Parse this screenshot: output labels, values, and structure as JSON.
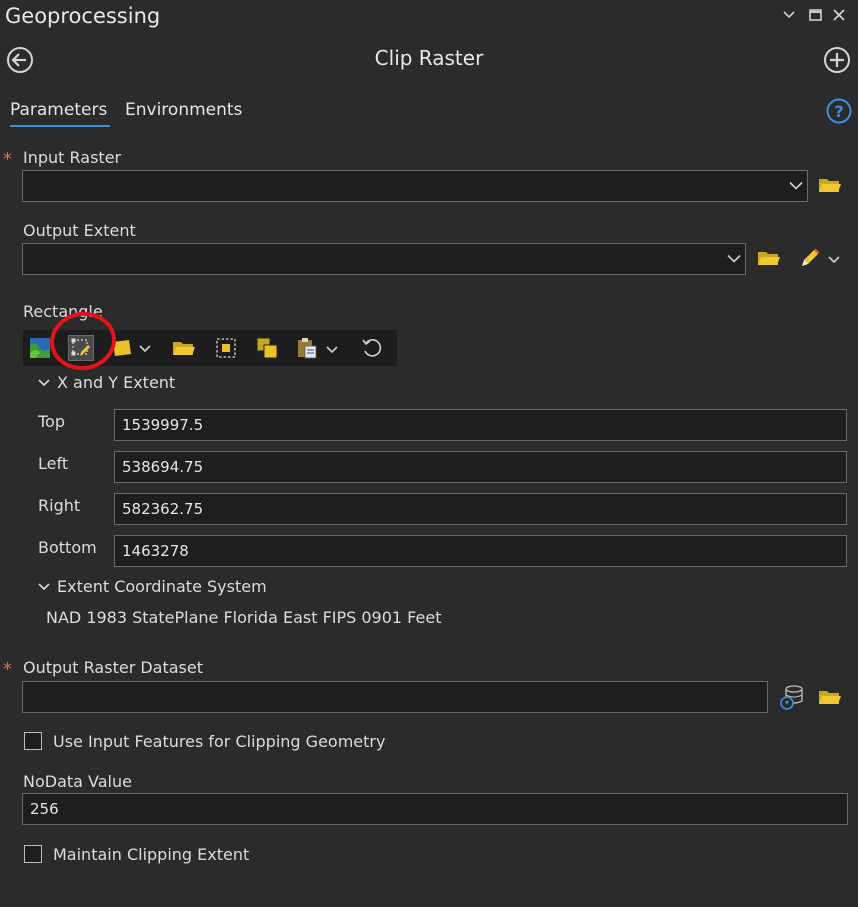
{
  "window": {
    "title": "Geoprocessing"
  },
  "tool": {
    "title": "Clip Raster"
  },
  "tabs": [
    {
      "label": "Parameters"
    },
    {
      "label": "Environments"
    }
  ],
  "input_raster": {
    "label": "Input Raster",
    "value": ""
  },
  "output_extent": {
    "label": "Output Extent",
    "value": ""
  },
  "rectangle": {
    "label": "Rectangle"
  },
  "xy_extent": {
    "header": "X and Y Extent",
    "top": {
      "label": "Top",
      "value": "1539997.5"
    },
    "left": {
      "label": "Left",
      "value": "538694.75"
    },
    "right": {
      "label": "Right",
      "value": "582362.75"
    },
    "bottom": {
      "label": "Bottom",
      "value": "1463278"
    }
  },
  "coord_system": {
    "header": "Extent Coordinate System",
    "value": "NAD 1983 StatePlane Florida East FIPS 0901 Feet"
  },
  "output_raster": {
    "label": "Output Raster Dataset",
    "value": ""
  },
  "use_input_features": {
    "label": "Use Input Features for Clipping Geometry",
    "checked": false
  },
  "nodata": {
    "label": "NoData Value",
    "value": "256"
  },
  "maintain_extent": {
    "label": "Maintain Clipping Extent",
    "checked": false
  },
  "colors": {
    "background": "#2b2b2b",
    "accent": "#3d8fe0",
    "required": "#e0723c",
    "annotation": "#e8101a"
  }
}
